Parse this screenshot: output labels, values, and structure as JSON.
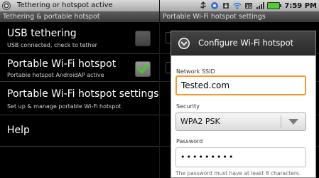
{
  "left": {
    "status_title": "Tethering or hotspot active",
    "title_bar": "Tethering & portable hotspot",
    "items": [
      {
        "title": "USB tethering",
        "subtitle": "USB connected, check to tether",
        "checkbox": "disabled"
      },
      {
        "title": "Portable Wi-Fi hotspot",
        "subtitle": "Portable hotspot AndroidAP active",
        "checkbox": "checked"
      },
      {
        "title": "Portable Wi-Fi hotspot settings",
        "subtitle": "Set up & manage portable Wi-Fi hotspot",
        "checkbox": "none"
      },
      {
        "title": "Help",
        "subtitle": "",
        "checkbox": "none"
      }
    ]
  },
  "right": {
    "title_bar": "Portable Wi-Fi hotspot settings",
    "time": "7:59 PM",
    "dialog": {
      "title": "Configure Wi-Fi hotspot",
      "ssid_label": "Network SSID",
      "ssid_value": "Tested.com",
      "security_label": "Security",
      "security_value": "WPA2 PSK",
      "password_label": "Password",
      "password_masked": "•••••••••",
      "hint": "The password must have at least 8 characters."
    }
  },
  "colors": {
    "focus": "#f39a2a",
    "check_green": "#3fcf1c",
    "battery_green": "#4bd02a"
  }
}
